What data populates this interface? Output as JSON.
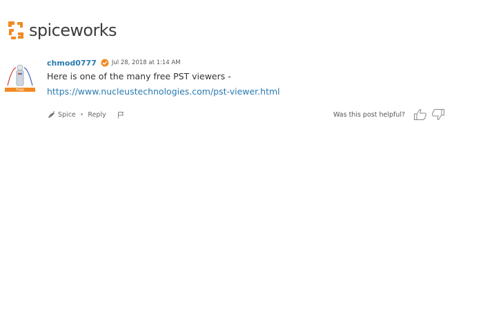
{
  "brand": {
    "name": "spiceworks",
    "accent_color": "#f08a24",
    "text_color": "#3c3c3c"
  },
  "post": {
    "author": "chmod0777",
    "timestamp": "Jul 28, 2018 at 1:14 AM",
    "body_text": "Here is one of the many free PST viewers - ",
    "link_text": "https://www.nucleustechnologies.com/pst-viewer.html",
    "avatar_caption": "THAI",
    "actions": {
      "spice_label": "Spice",
      "separator": "•",
      "reply_label": "Reply"
    },
    "helpful": {
      "label": "Was this post helpful?"
    },
    "link_color": "#2a7ab0"
  },
  "icons": {
    "logo": "spiceworks-logo-icon",
    "badge": "verified-badge-icon",
    "spice": "spice-pepper-icon",
    "flag": "flag-icon",
    "thumbs_up": "thumbs-up-icon",
    "thumbs_down": "thumbs-down-icon"
  }
}
